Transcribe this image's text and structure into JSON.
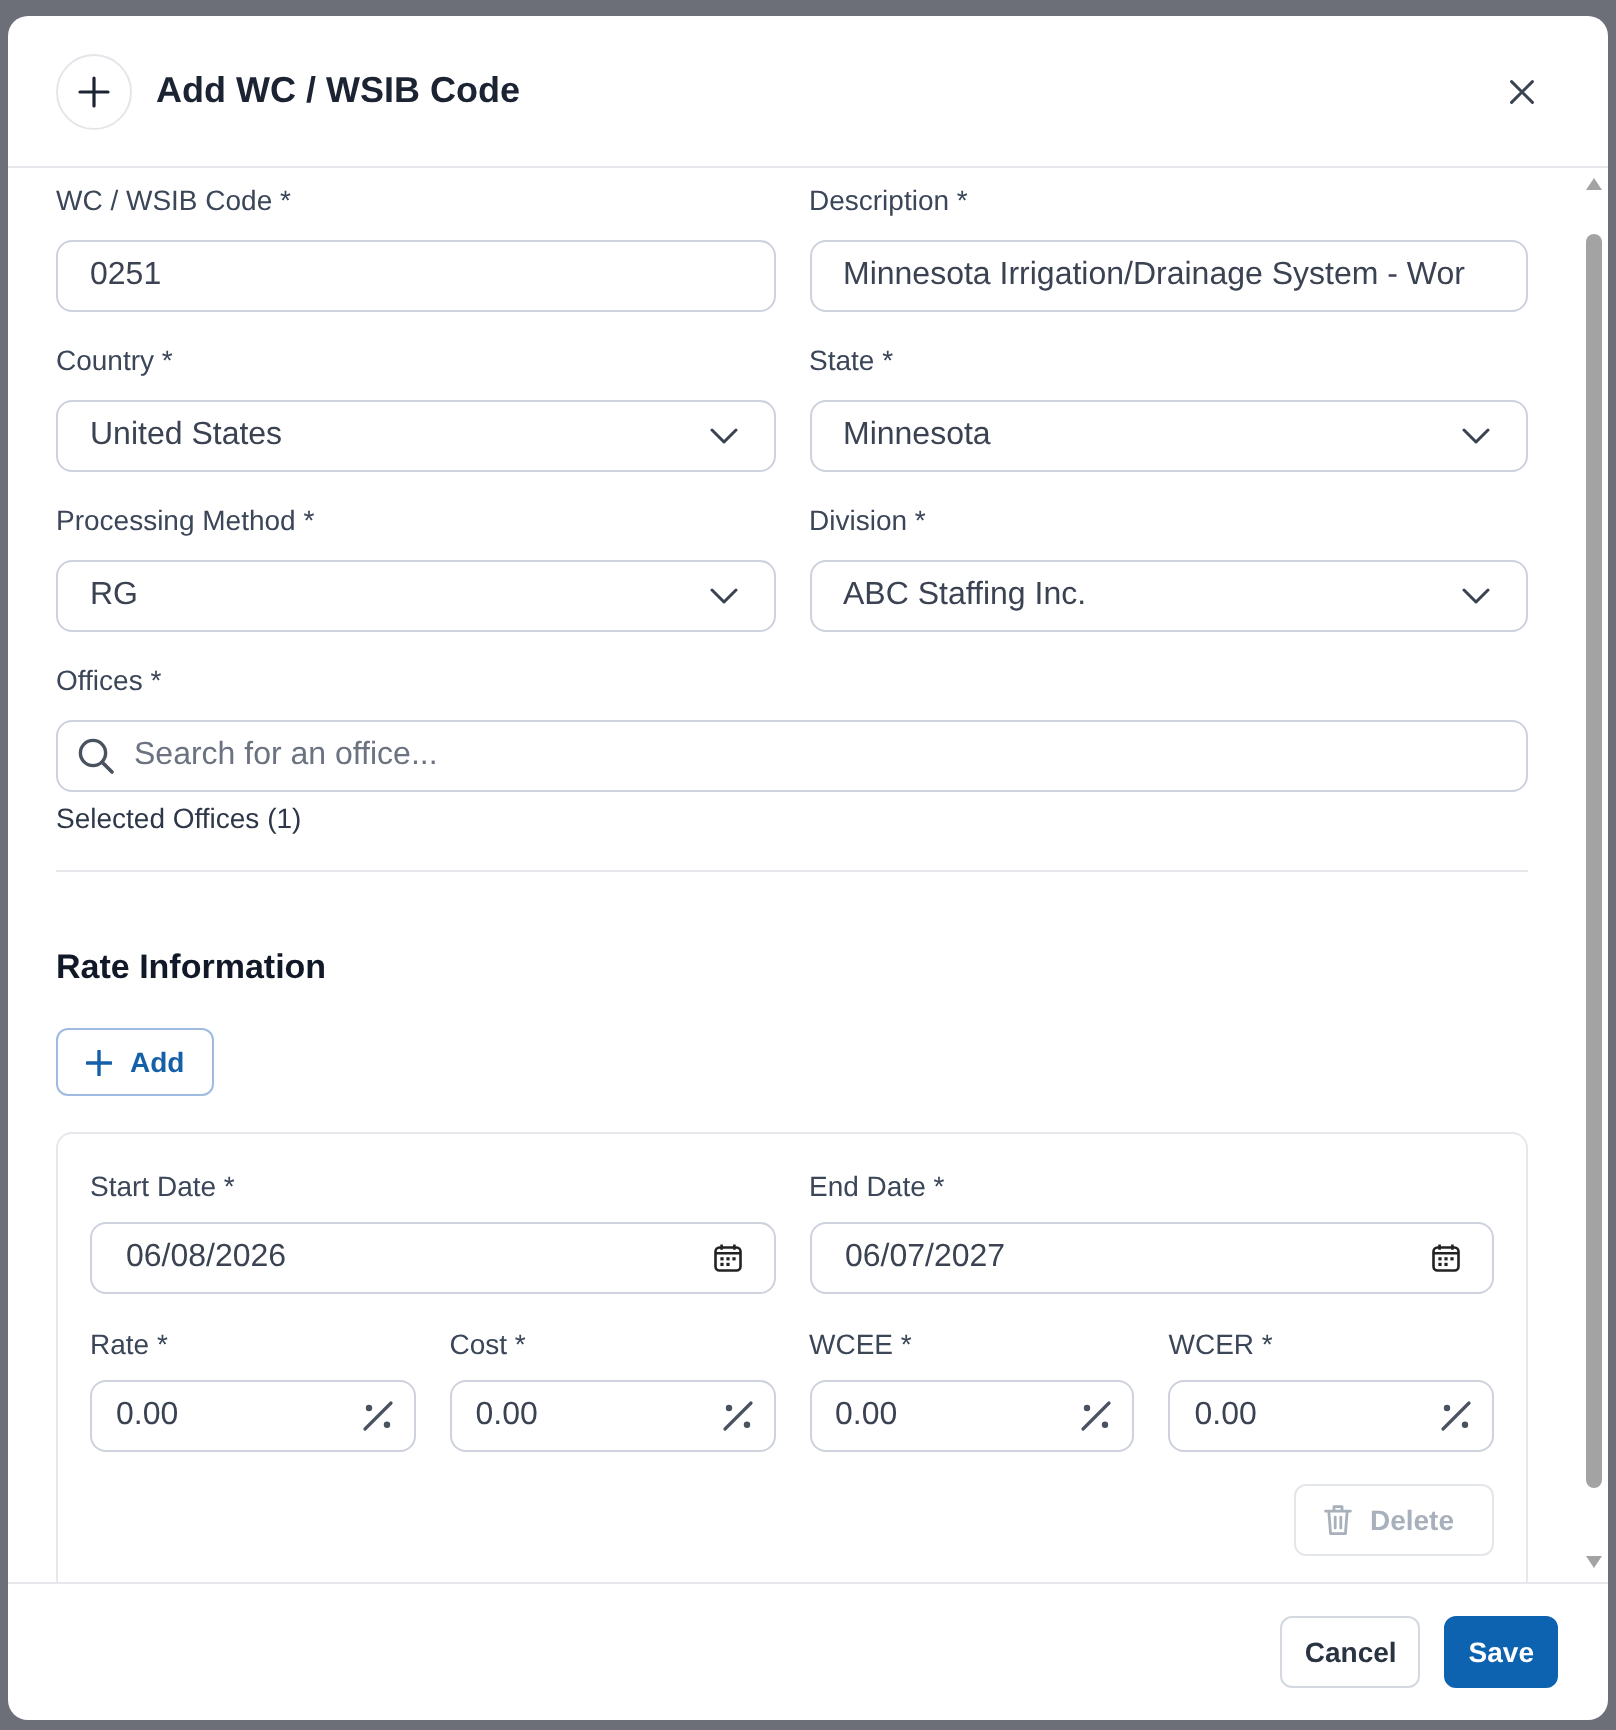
{
  "dialog": {
    "title": "Add WC / WSIB Code"
  },
  "fields": [
    {
      "kind": "text",
      "label": "WC / WSIB Code *",
      "value": "0251"
    },
    {
      "kind": "text",
      "label": "Description *",
      "value": "Minnesota Irrigation/Drainage System - Wor"
    },
    {
      "kind": "select",
      "label": "Country *",
      "value": "United States"
    },
    {
      "kind": "select",
      "label": "State *",
      "value": "Minnesota"
    },
    {
      "kind": "select",
      "label": "Processing Method *",
      "value": "RG"
    },
    {
      "kind": "select",
      "label": "Division *",
      "value": "ABC Staffing Inc."
    },
    {
      "kind": "search",
      "label": "Offices *",
      "placeholder": "Search for an office..."
    }
  ],
  "selected_offices": "Selected Offices (1)",
  "rate_information": {
    "title": "Rate Information",
    "add_button": "Add",
    "entries": [
      {
        "fields": [
          {
            "kind": "date",
            "label": "Start Date *",
            "value": "06/08/2026"
          },
          {
            "kind": "date",
            "label": "End Date *",
            "value": "06/07/2027"
          },
          {
            "kind": "percent",
            "label": "Rate *",
            "value": "0.00"
          },
          {
            "kind": "percent",
            "label": "Cost *",
            "value": "0.00"
          },
          {
            "kind": "percent",
            "label": "WCEE *",
            "value": "0.00"
          },
          {
            "kind": "percent",
            "label": "WCER *",
            "value": "0.00"
          }
        ],
        "delete_button": {
          "label": "Delete",
          "disabled": true
        }
      }
    ]
  },
  "footer": {
    "buttons": [
      {
        "kind": "secondary",
        "label": "Cancel"
      },
      {
        "kind": "primary",
        "label": "Save"
      }
    ]
  }
}
